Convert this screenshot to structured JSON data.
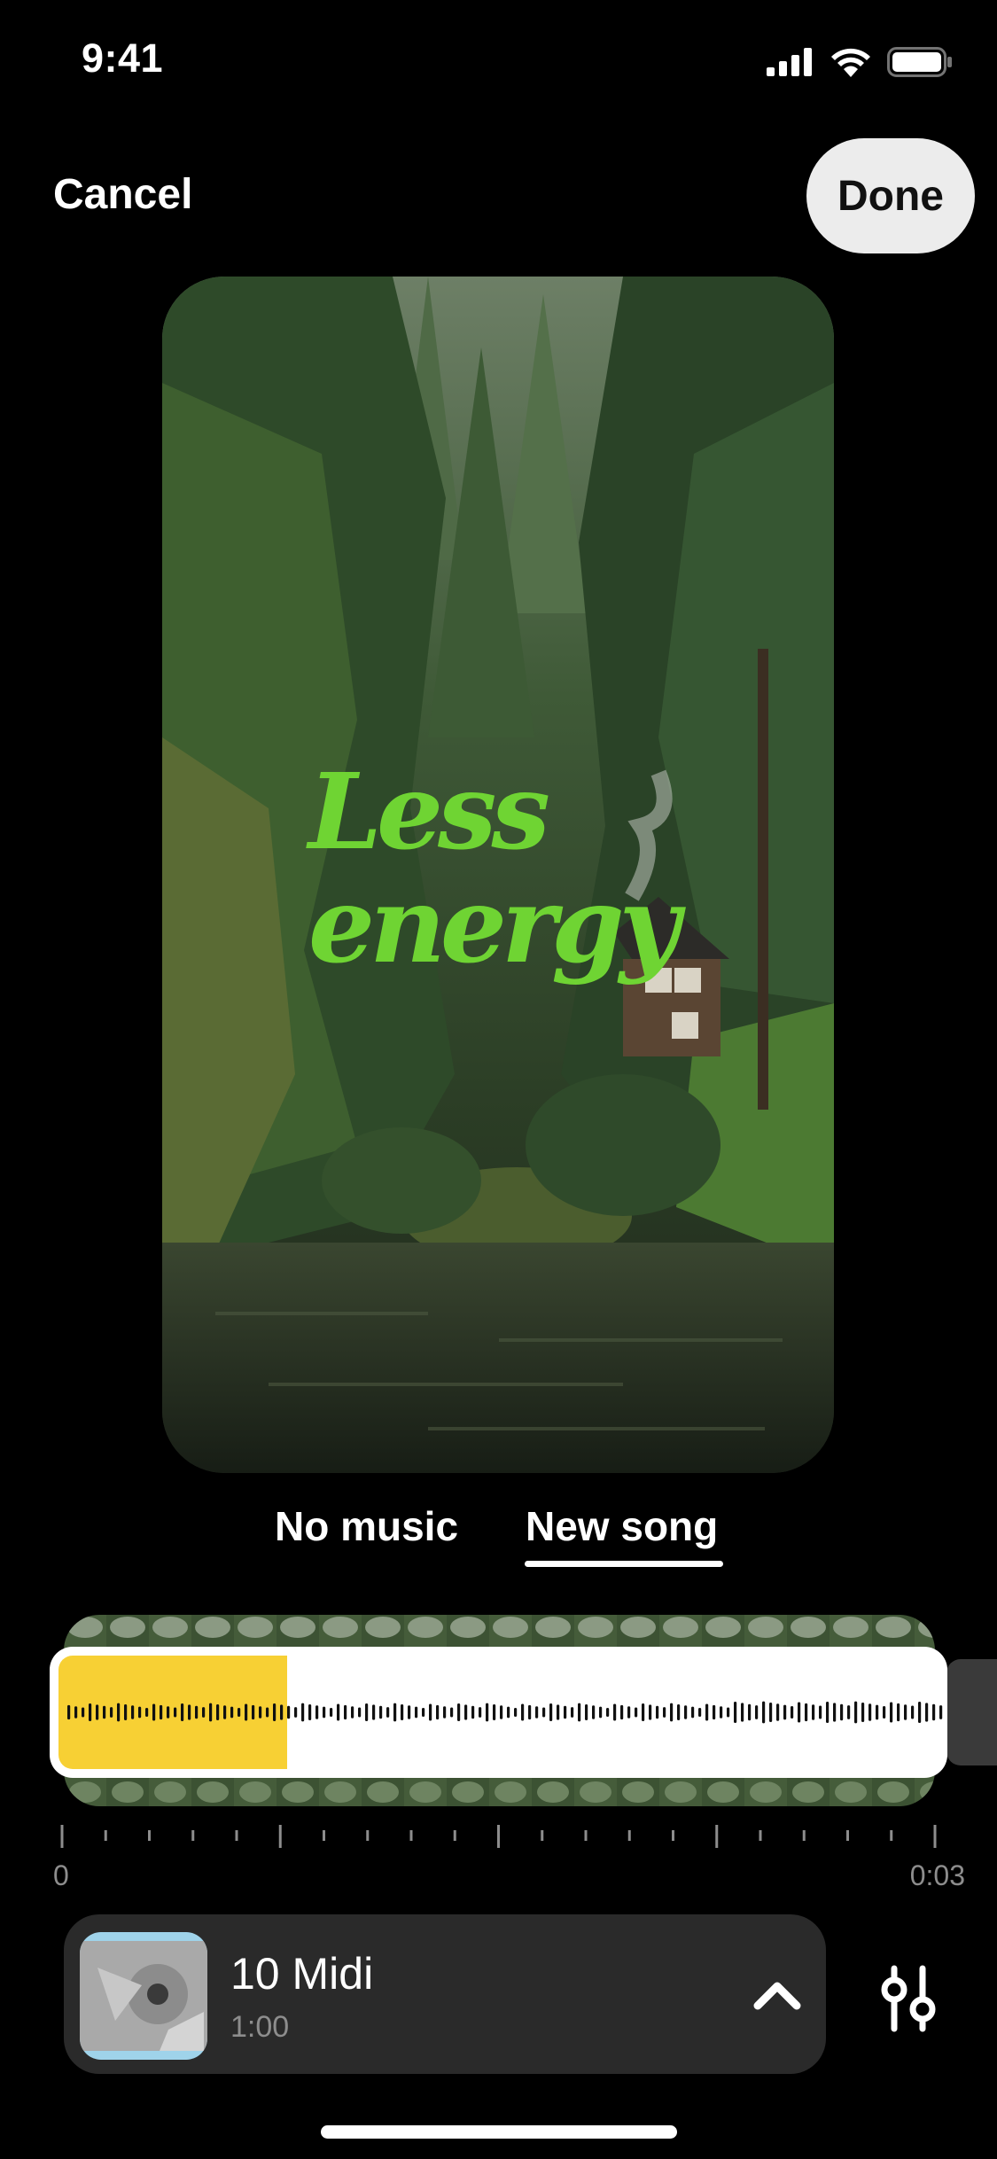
{
  "status_bar": {
    "time": "9:41"
  },
  "header": {
    "cancel_label": "Cancel",
    "done_label": "Done"
  },
  "preview": {
    "overlay_text": "Less\nenergy",
    "overlay_color": "#6fd433"
  },
  "music_tabs": [
    {
      "label": "No music",
      "selected": false
    },
    {
      "label": "New song",
      "selected": true
    }
  ],
  "timeline": {
    "start_label": "0",
    "end_label": "0:03",
    "selection_color": "#f7d034",
    "selection_fraction": 0.26
  },
  "song": {
    "title": "10 Midi",
    "duration": "1:00"
  },
  "icons": {
    "signal": "cellular-signal-icon",
    "wifi": "wifi-icon",
    "battery": "battery-icon",
    "expand": "chevron-up-icon",
    "adjust": "sliders-icon"
  }
}
